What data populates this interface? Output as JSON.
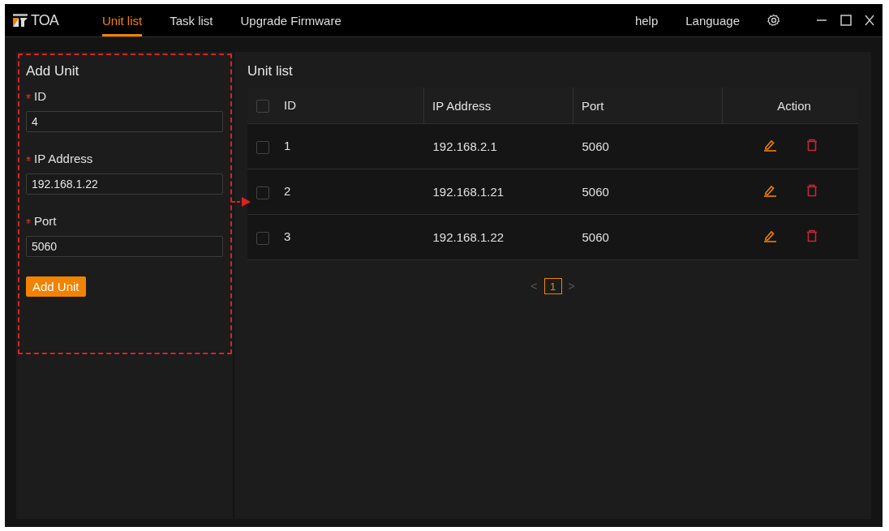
{
  "app": {
    "logo": "TOA"
  },
  "tabs": [
    {
      "label": "Unit list",
      "selected": true
    },
    {
      "label": "Task list",
      "selected": false
    },
    {
      "label": "Upgrade Firmware",
      "selected": false
    }
  ],
  "top_links": [
    "help",
    "Language"
  ],
  "add_unit": {
    "title": "Add Unit",
    "fields": [
      {
        "label": "ID",
        "required": true,
        "value": "4"
      },
      {
        "label": "IP Address",
        "required": true,
        "value": "192.168.1.22"
      },
      {
        "label": "Port",
        "required": true,
        "value": "5060"
      }
    ],
    "button": "Add Unit",
    "highlighted": true
  },
  "unit_list": {
    "title": "Unit list",
    "header_checked": false,
    "columns": [
      "ID",
      "IP Address",
      "Port",
      "Action"
    ],
    "rows": [
      {
        "checked": false,
        "id": "1",
        "ip": "192.168.2.1",
        "port": "5060"
      },
      {
        "checked": false,
        "id": "2",
        "ip": "192.168.1.21",
        "port": "5060"
      },
      {
        "checked": false,
        "id": "3",
        "ip": "192.168.1.22",
        "port": "5060"
      }
    ]
  },
  "pagination": {
    "prev": "<",
    "pages": [
      {
        "label": "1",
        "selected": true
      }
    ],
    "next": ">"
  }
}
